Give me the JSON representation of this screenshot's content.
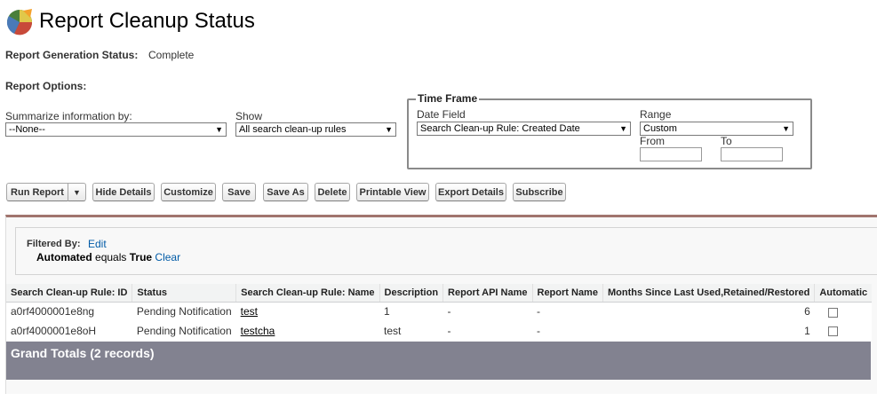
{
  "header": {
    "title": "Report Cleanup Status",
    "icon": "report-pie-icon"
  },
  "status": {
    "label": "Report Generation Status:",
    "value": "Complete"
  },
  "options": {
    "label": "Report Options:",
    "summarize_label": "Summarize information by:",
    "summarize_value": "--None--",
    "show_label": "Show",
    "show_value": "All search clean-up rules"
  },
  "timeframe": {
    "legend": "Time Frame",
    "date_field_label": "Date Field",
    "date_field_value": "Search Clean-up Rule: Created Date",
    "range_label": "Range",
    "range_value": "Custom",
    "from_label": "From",
    "to_label": "To",
    "from_value": "",
    "to_value": ""
  },
  "toolbar": {
    "run_report": "Run Report",
    "run_report_arrow": "▼",
    "hide_details": "Hide Details",
    "customize": "Customize",
    "save": "Save",
    "save_as": "Save As",
    "delete": "Delete",
    "printable_view": "Printable View",
    "export_details": "Export Details",
    "subscribe": "Subscribe"
  },
  "filter": {
    "filtered_by_label": "Filtered By:",
    "edit_link": "Edit",
    "field": "Automated",
    "operator": "equals",
    "value": "True",
    "clear_link": "Clear"
  },
  "table": {
    "columns": [
      "Search Clean-up Rule: ID",
      "Status",
      "Search Clean-up Rule: Name",
      "Description",
      "Report API Name",
      "Report Name",
      "Months Since Last Used,Retained/Restored",
      "Automatic"
    ],
    "rows": [
      {
        "id": "a0rf4000001e8ng",
        "status": "Pending Notification",
        "name": "test",
        "description": "1",
        "api_name": "-",
        "report_name": "-",
        "months": "6",
        "automatic": false
      },
      {
        "id": "a0rf4000001e8oH",
        "status": "Pending Notification",
        "name": "testcha",
        "description": "test",
        "api_name": "-",
        "report_name": "-",
        "months": "1",
        "automatic": false
      }
    ]
  },
  "totals": {
    "label": "Grand Totals (2 records)"
  }
}
